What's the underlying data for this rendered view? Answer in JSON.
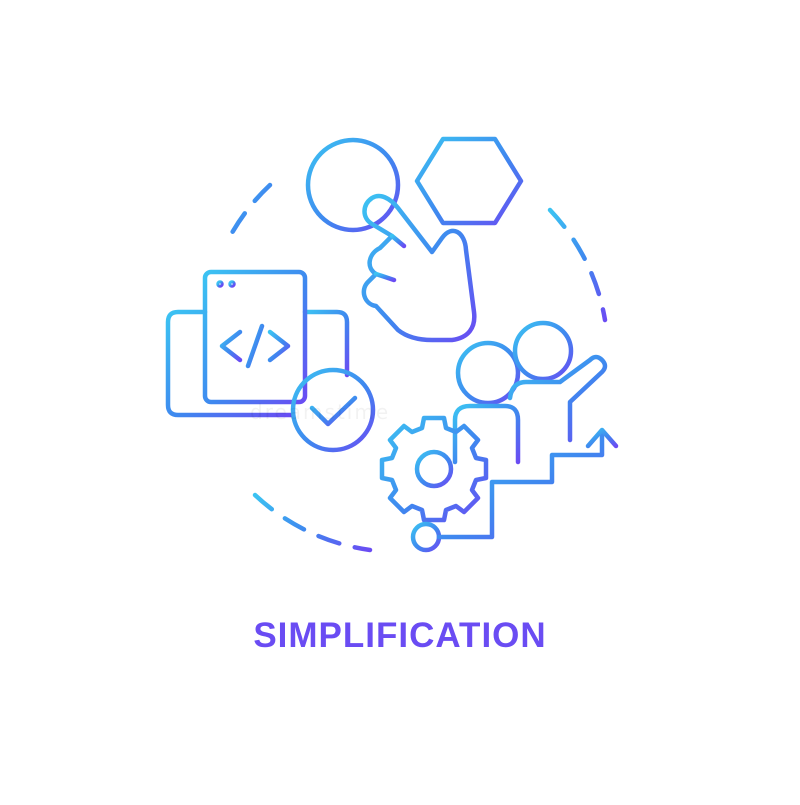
{
  "caption": "SIMPLIFICATION",
  "watermark": "dreamstime",
  "colors": {
    "gradient_start": "#3cc3f2",
    "gradient_mid": "#3f87ef",
    "gradient_end": "#6a4cf3"
  },
  "icons": [
    "dashed-circle-frame",
    "circle-shape-icon",
    "hexagon-shape-icon",
    "pointing-hand-icon",
    "monitor-icon",
    "code-window-icon",
    "checkmark-badge-icon",
    "people-icon",
    "gear-icon",
    "growth-steps-arrow-icon"
  ]
}
